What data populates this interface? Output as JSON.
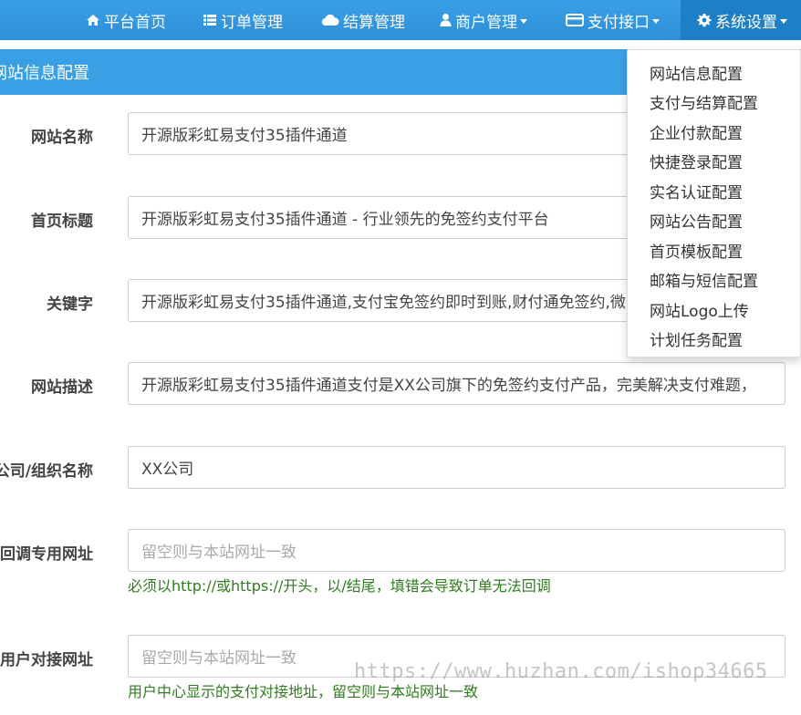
{
  "nav": {
    "home": "平台首页",
    "orders": "订单管理",
    "settlement": "结算管理",
    "merchants": "商户管理",
    "payment": "支付接口",
    "settings": "系统设置"
  },
  "panel": {
    "title": "网站信息配置"
  },
  "form": {
    "site_name": {
      "label": "网站名称",
      "value": "开源版彩虹易支付35插件通道"
    },
    "home_title": {
      "label": "首页标题",
      "value": "开源版彩虹易支付35插件通道 - 行业领先的免签约支付平台"
    },
    "keywords": {
      "label": "关键字",
      "value": "开源版彩虹易支付35插件通道,支付宝免签约即时到账,财付通免签约,微"
    },
    "description": {
      "label": "网站描述",
      "value": "开源版彩虹易支付35插件通道支付是XX公司旗下的免签约支付产品，完美解决支付难题，"
    },
    "company": {
      "label": "公司/组织名称",
      "value": "XX公司"
    },
    "callback_url": {
      "label": "回调专用网址",
      "placeholder": "留空则与本站网址一致",
      "help": "必须以http://或https://开头，以/结尾，填错会导致订单无法回调"
    },
    "user_api_url": {
      "label": "用户对接网址",
      "placeholder": "留空则与本站网址一致",
      "help": "用户中心显示的支付对接地址，留空则与本站网址一致"
    }
  },
  "dropdown": {
    "items": [
      "网站信息配置",
      "支付与结算配置",
      "企业付款配置",
      "快捷登录配置",
      "实名认证配置",
      "网站公告配置",
      "首页模板配置",
      "邮箱与短信配置",
      "网站Logo上传",
      "计划任务配置"
    ]
  },
  "watermark": "https://www.huzhan.com/ishop34665",
  "colors": {
    "navbar": "#2c8fd8",
    "panel_header": "#3aa0e6",
    "help_text": "#2e7d1e"
  },
  "icons": [
    "home-icon",
    "list-icon",
    "cloud-icon",
    "user-icon",
    "credit-card-icon",
    "gear-icon"
  ]
}
